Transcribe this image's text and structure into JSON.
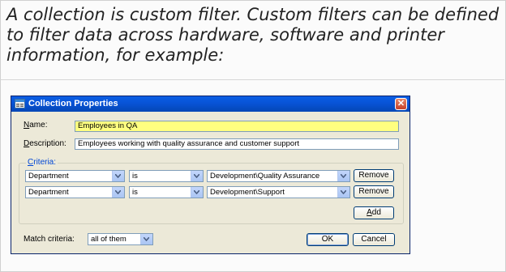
{
  "intro_text": "A collection is custom filter. Custom filters can be defined to filter data across hardware, software and printer information, for example:",
  "dialog": {
    "title": "Collection Properties",
    "close_glyph": "✕",
    "name_label_key": "N",
    "name_label_rest": "ame:",
    "name_value": "Employees in QA",
    "description_label_key": "D",
    "description_label_rest": "escription:",
    "description_value": "Employees working with quality assurance and customer support",
    "criteria_label_key": "C",
    "criteria_label_rest": "riteria:",
    "criteria_rows": [
      {
        "field": "Department",
        "operator": "is",
        "value": "Development\\Quality Assurance",
        "remove_label": "Remove"
      },
      {
        "field": "Department",
        "operator": "is",
        "value": "Development\\Support",
        "remove_label": "Remove"
      }
    ],
    "add_label_key": "A",
    "add_label_rest": "dd",
    "match_label": "Match criteria:",
    "match_value": "all of them",
    "ok_label": "OK",
    "cancel_label": "Cancel"
  },
  "icons": {
    "title": "collection-icon",
    "close": "close-icon",
    "dropdown": "chevron-down-icon"
  },
  "colors": {
    "titlebar": "#0853d6",
    "dialog_bg": "#ece9d8",
    "highlight_field": "#ffff80",
    "group_label": "#0046d5"
  }
}
